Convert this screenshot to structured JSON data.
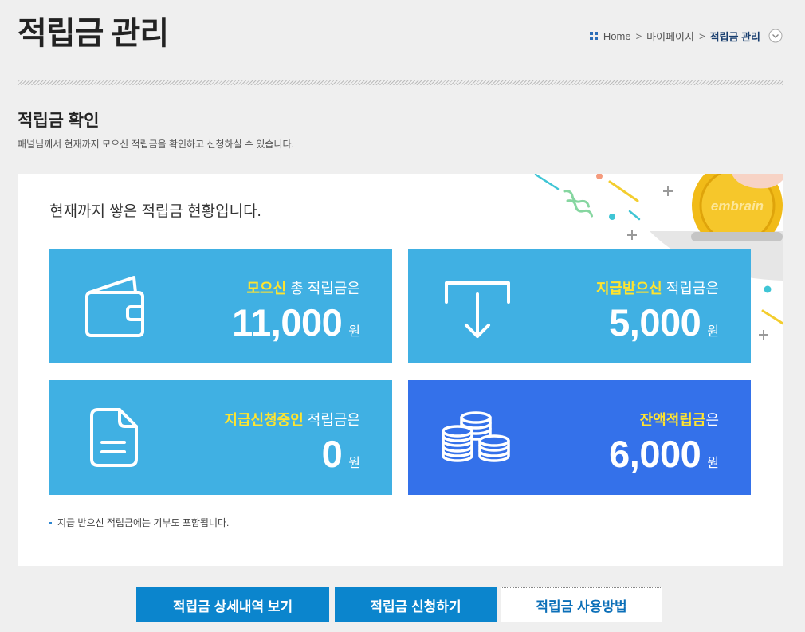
{
  "header": {
    "title": "적립금 관리",
    "breadcrumb": {
      "items": [
        "Home",
        "마이페이지",
        "적립금 관리"
      ],
      "separator": ">",
      "home_icon": "grid-icon",
      "toggle_icon": "chevron-down-circle-icon"
    }
  },
  "section": {
    "title": "적립금 확인",
    "description": "패널님께서 현재까지 모으신 적립금을 확인하고 신청하실 수 있습니다."
  },
  "panel": {
    "heading": "현재까지 쌓은 적립금 현황입니다.",
    "logo_text": "embrain",
    "cards": [
      {
        "icon": "wallet-icon",
        "highlight": "모으신",
        "label_rest": " 총 적립금은",
        "amount": "11,000",
        "unit": "원",
        "color": "#40b0e3"
      },
      {
        "icon": "receive-download-icon",
        "highlight": "지급받으신",
        "label_rest": " 적립금은",
        "amount": "5,000",
        "unit": "원",
        "color": "#40b0e3"
      },
      {
        "icon": "document-icon",
        "highlight": "지급신청중인",
        "label_rest": " 적립금은",
        "amount": "0",
        "unit": "원",
        "color": "#40b0e3"
      },
      {
        "icon": "coin-stack-icon",
        "highlight": "잔액적립금",
        "label_rest": "은",
        "amount": "6,000",
        "unit": "원",
        "color": "#3471ea"
      }
    ],
    "note": "지급 받으신 적립금에는 기부도 포함됩니다."
  },
  "buttons": [
    {
      "label": "적립금 상세내역 보기"
    },
    {
      "label": "적립금 신청하기"
    },
    {
      "label": "적립금 사용방법"
    }
  ],
  "colors": {
    "page_background": "#efefef",
    "card_light_blue": "#40b0e3",
    "card_dark_blue": "#3471ea",
    "highlight_yellow": "#ffe42e",
    "button_blue": "#0b85cd",
    "breadcrumb_current": "#173d6e"
  }
}
